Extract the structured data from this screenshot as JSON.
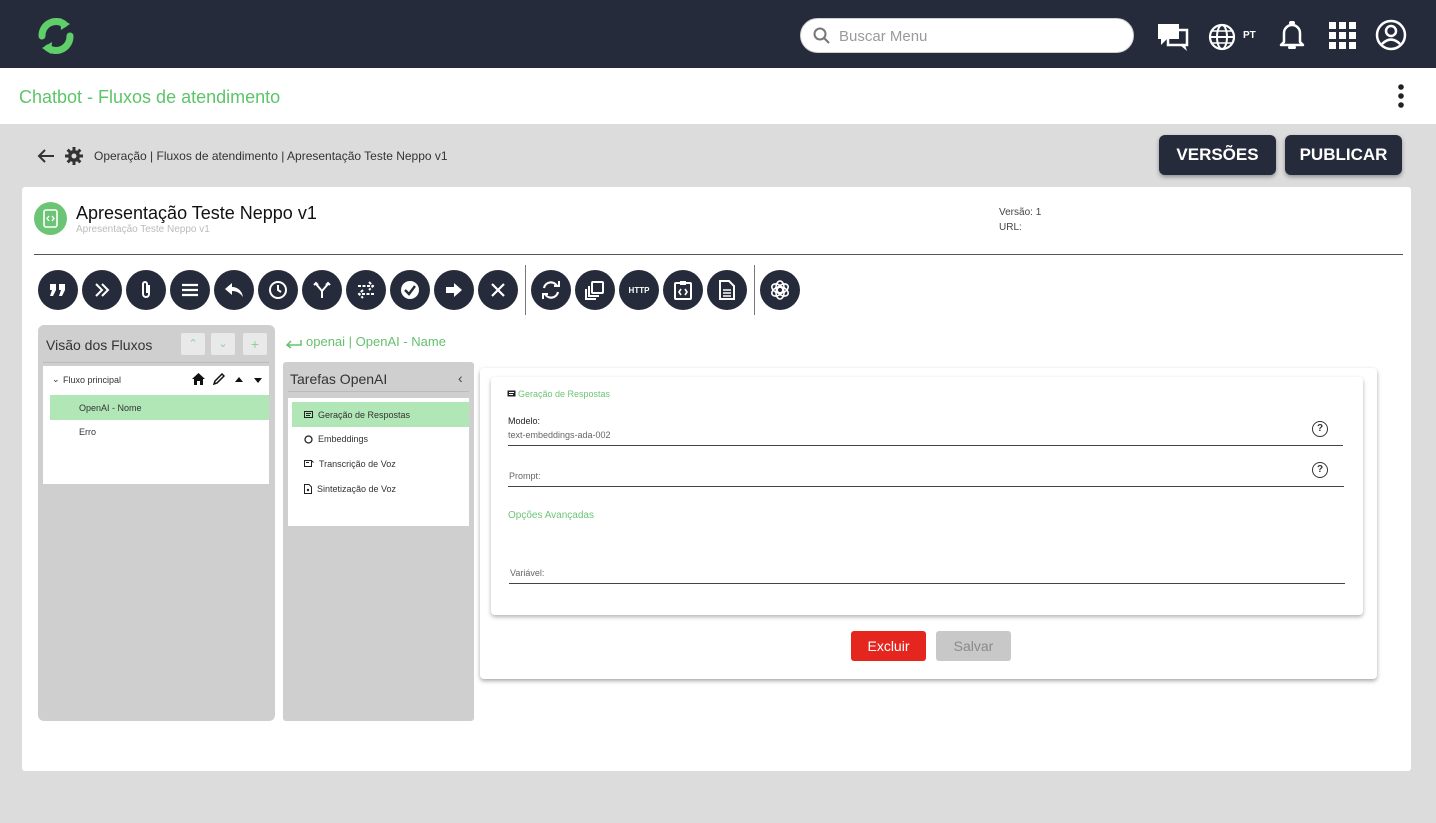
{
  "topbar": {
    "search_placeholder": "Buscar Menu",
    "language": "PT"
  },
  "subheader": {
    "title": "Chatbot - Fluxos de atendimento"
  },
  "breadcrumb": "Operação | Fluxos de atendimento | Apresentação Teste Neppo v1",
  "actions": {
    "versions": "VERSÕES",
    "publish": "PUBLICAR"
  },
  "flow": {
    "title": "Apresentação Teste Neppo v1",
    "subtitle": "Apresentação Teste Neppo v1",
    "version_label": "Versão: 1",
    "url_label": "URL:"
  },
  "toolbar_icons": [
    "quote-icon",
    "double-chevron-icon",
    "attachment-icon",
    "menu-icon",
    "reply-icon",
    "clock-icon",
    "fork-icon",
    "swap-icon",
    "check-icon",
    "arrow-right-icon",
    "close-icon",
    "sync-icon",
    "copy-icon",
    "http-icon",
    "code-clipboard-icon",
    "document-icon",
    "openai-icon"
  ],
  "http_label": "HTTP",
  "left_panel": {
    "title": "Visão dos Fluxos",
    "tree": {
      "root": "Fluxo principal",
      "items": [
        "OpenAI - Nome",
        "Erro"
      ]
    }
  },
  "back_link": "openai | OpenAI - Name",
  "mid_panel": {
    "title": "Tarefas OpenAI",
    "tasks": [
      "Geração de Respostas",
      "Embeddings",
      "Transcrição de Voz",
      "Sintetização de Voz"
    ]
  },
  "form": {
    "section": "Geração de Respostas",
    "model_label": "Modelo:",
    "model_value": "text-embeddings-ada-002",
    "prompt_label": "Prompt:",
    "advanced": "Opções Avançadas",
    "variable_label": "Variável:",
    "help_glyph": "?",
    "delete": "Excluir",
    "save": "Salvar"
  },
  "colors": {
    "navy": "#262b3b",
    "green": "#6cc575",
    "selected": "#b1e6b7",
    "red": "#e5261f"
  }
}
